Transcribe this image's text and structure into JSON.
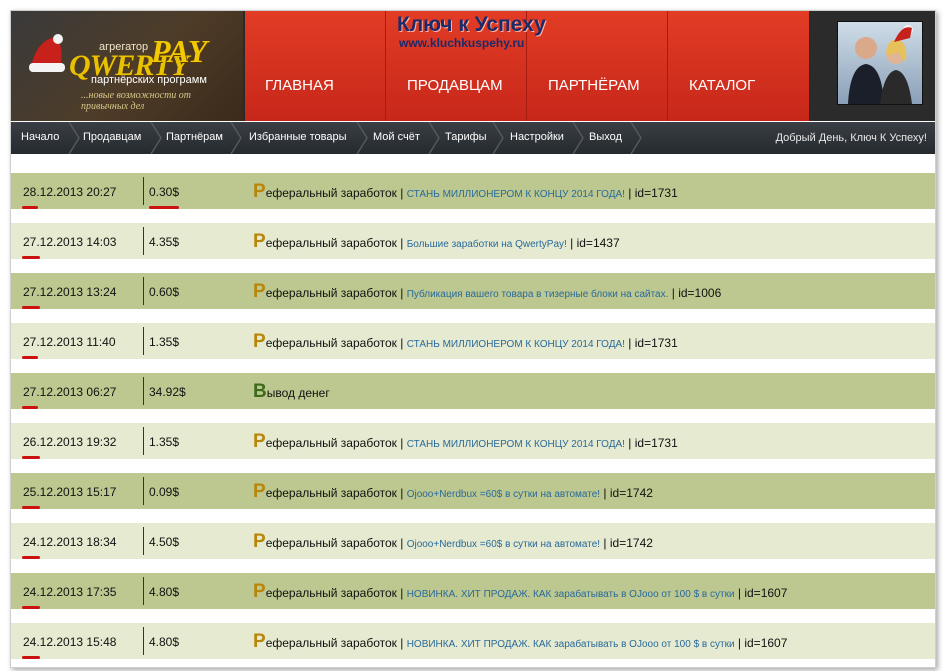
{
  "header": {
    "logo": {
      "aggregator": "агрегатор",
      "brand_a": "QWERTY",
      "brand_b": "PAY",
      "subtitle": "партнёрских программ",
      "slogan": "...новые возможности от привычных дел"
    },
    "site_title": "Ключ к Успеху",
    "site_url": "www.kluchkuspehy.ru",
    "menu": [
      "ГЛАВНАЯ",
      "ПРОДАВЦАМ",
      "ПАРТНЁРАМ",
      "КАТАЛОГ"
    ]
  },
  "breadcrumbs": [
    "Начало",
    "Продавцам",
    "Партнёрам",
    "Избранные товары",
    "Мой счёт",
    "Тарифы",
    "Настройки",
    "Выход"
  ],
  "greeting": "Добрый День, Ключ К Успеху!",
  "rows": [
    {
      "date": "28.12.2013 20:27",
      "amount": "0.30$",
      "type_initial": "Р",
      "type_rest": "еферальный заработок",
      "separator_a": " | ",
      "link": "СТАНЬ МИЛЛИОНЕРОМ К КОНЦУ 2014 ГОДА!",
      "separator_b": " | ",
      "id": "id=1731"
    },
    {
      "date": "27.12.2013 14:03",
      "amount": "4.35$",
      "type_initial": "Р",
      "type_rest": "еферальный заработок",
      "separator_a": " | ",
      "link": "Большие заработки на QwertyPay!",
      "separator_b": " | ",
      "id": "id=1437"
    },
    {
      "date": "27.12.2013 13:24",
      "amount": "0.60$",
      "type_initial": "Р",
      "type_rest": "еферальный заработок",
      "separator_a": " | ",
      "link": "Публикация вашего товара в тизерные блоки на сайтах.",
      "separator_b": " | ",
      "id": "id=1006"
    },
    {
      "date": "27.12.2013 11:40",
      "amount": "1.35$",
      "type_initial": "Р",
      "type_rest": "еферальный заработок",
      "separator_a": " | ",
      "link": "СТАНЬ МИЛЛИОНЕРОМ К КОНЦУ 2014 ГОДА!",
      "separator_b": " | ",
      "id": "id=1731"
    },
    {
      "date": "27.12.2013 06:27",
      "amount": "34.92$",
      "type_initial": "В",
      "type_rest": "ывод денег",
      "separator_a": "",
      "link": "",
      "separator_b": "",
      "id": ""
    },
    {
      "date": "26.12.2013 19:32",
      "amount": "1.35$",
      "type_initial": "Р",
      "type_rest": "еферальный заработок",
      "separator_a": " | ",
      "link": "СТАНЬ МИЛЛИОНЕРОМ К КОНЦУ 2014 ГОДА!",
      "separator_b": " | ",
      "id": "id=1731"
    },
    {
      "date": "25.12.2013 15:17",
      "amount": "0.09$",
      "type_initial": "Р",
      "type_rest": "еферальный заработок",
      "separator_a": " | ",
      "link": "Ojooo+Nerdbux =60$ в сутки на автомате!",
      "separator_b": " | ",
      "id": "id=1742"
    },
    {
      "date": "24.12.2013 18:34",
      "amount": "4.50$",
      "type_initial": "Р",
      "type_rest": "еферальный заработок",
      "separator_a": " | ",
      "link": "Ojooo+Nerdbux =60$ в сутки на автомате!",
      "separator_b": " | ",
      "id": "id=1742"
    },
    {
      "date": "24.12.2013 17:35",
      "amount": "4.80$",
      "type_initial": "Р",
      "type_rest": "еферальный заработок",
      "separator_a": " | ",
      "link": "НОВИНКА. ХИТ ПРОДАЖ. КАК зарабатывать в OJooo от 100 $ в сутки",
      "separator_b": " | ",
      "id": "id=1607"
    },
    {
      "date": "24.12.2013 15:48",
      "amount": "4.80$",
      "type_initial": "Р",
      "type_rest": "еферальный заработок",
      "separator_a": " | ",
      "link": "НОВИНКА. ХИТ ПРОДАЖ. КАК зарабатывать в OJooo от 100 $ в сутки",
      "separator_b": " | ",
      "id": "id=1607"
    }
  ],
  "colors": {
    "nav_red": "#d8321f",
    "row_dark": "#bcc88f",
    "row_light": "#e5ead0",
    "bar_dark": "#2e3338",
    "accent_gold": "#b8860b",
    "withdraw_green": "#3d6b1a",
    "annotation_red": "#cc1111"
  },
  "icons": [
    "santa-hat-icon",
    "chevron-separator-icon",
    "profile-photo"
  ]
}
